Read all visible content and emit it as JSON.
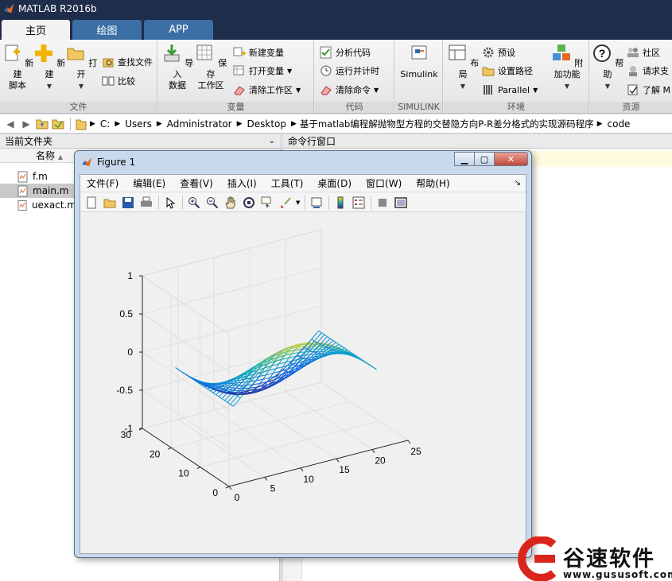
{
  "app": {
    "title": "MATLAB R2016b"
  },
  "tabs": [
    "主页",
    "绘图",
    "APP"
  ],
  "ribbon": {
    "file": {
      "label": "文件",
      "new_script": "新建\n脚本",
      "new": "新建",
      "open": "打开",
      "find_files": "查找文件",
      "compare": "比较"
    },
    "variable": {
      "label": "变量",
      "import_data": "导入\n数据",
      "save_workspace": "保存\n工作区",
      "new_variable": "新建变量",
      "open_variable": "打开变量",
      "clear_workspace": "清除工作区"
    },
    "code": {
      "label": "代码",
      "analyze": "分析代码",
      "run_time": "运行并计时",
      "clear_commands": "清除命令"
    },
    "simulink": {
      "label": "SIMULINK",
      "simulink": "Simulink"
    },
    "environment": {
      "label": "环境",
      "layout": "布局",
      "preferences": "预设",
      "set_path": "设置路径",
      "parallel": "Parallel",
      "addons": "附加功能"
    },
    "resources": {
      "label": "资源",
      "help": "帮助",
      "community": "社区",
      "request_support": "请求支",
      "learn": "了解 M"
    }
  },
  "address": [
    "C:",
    "Users",
    "Administrator",
    "Desktop",
    "基于matlab编程解抛物型方程的交替隐方向P-R差分格式的实现源码程序",
    "code"
  ],
  "file_panel": {
    "header": "当前文件夹",
    "name_col": "名称",
    "files": [
      "f.m",
      "main.m",
      "uexact.m"
    ],
    "selected": 1
  },
  "command_panel": {
    "header": "命令行窗口"
  },
  "figure": {
    "title": "Figure 1",
    "menu": [
      "文件(F)",
      "编辑(E)",
      "查看(V)",
      "插入(I)",
      "工具(T)",
      "桌面(D)",
      "窗口(W)",
      "帮助(H)"
    ]
  },
  "chart_data": {
    "type": "surface-mesh",
    "title": "",
    "xlabel": "",
    "ylabel": "",
    "zlabel": "",
    "xlim": [
      0,
      25
    ],
    "ylim": [
      0,
      30
    ],
    "zlim": [
      -1,
      1
    ],
    "xticks": [
      0,
      5,
      10,
      15,
      20,
      25
    ],
    "yticks": [
      0,
      10,
      20,
      30
    ],
    "zticks": [
      -1,
      -0.5,
      0,
      0.5,
      1
    ],
    "grid": true,
    "colormap": "parula",
    "mesh_x": [
      1,
      21
    ],
    "mesh_y": [
      1,
      21
    ],
    "mesh_step": 1,
    "surface_formula": "z = sin(pi*(x-1)/20 * 2 - pi/2) approx, amplitude 0.5",
    "z_range_shown": [
      -0.6,
      0.55
    ]
  },
  "watermark": {
    "brand": "谷速软件",
    "url": "www.gususoft.com"
  }
}
